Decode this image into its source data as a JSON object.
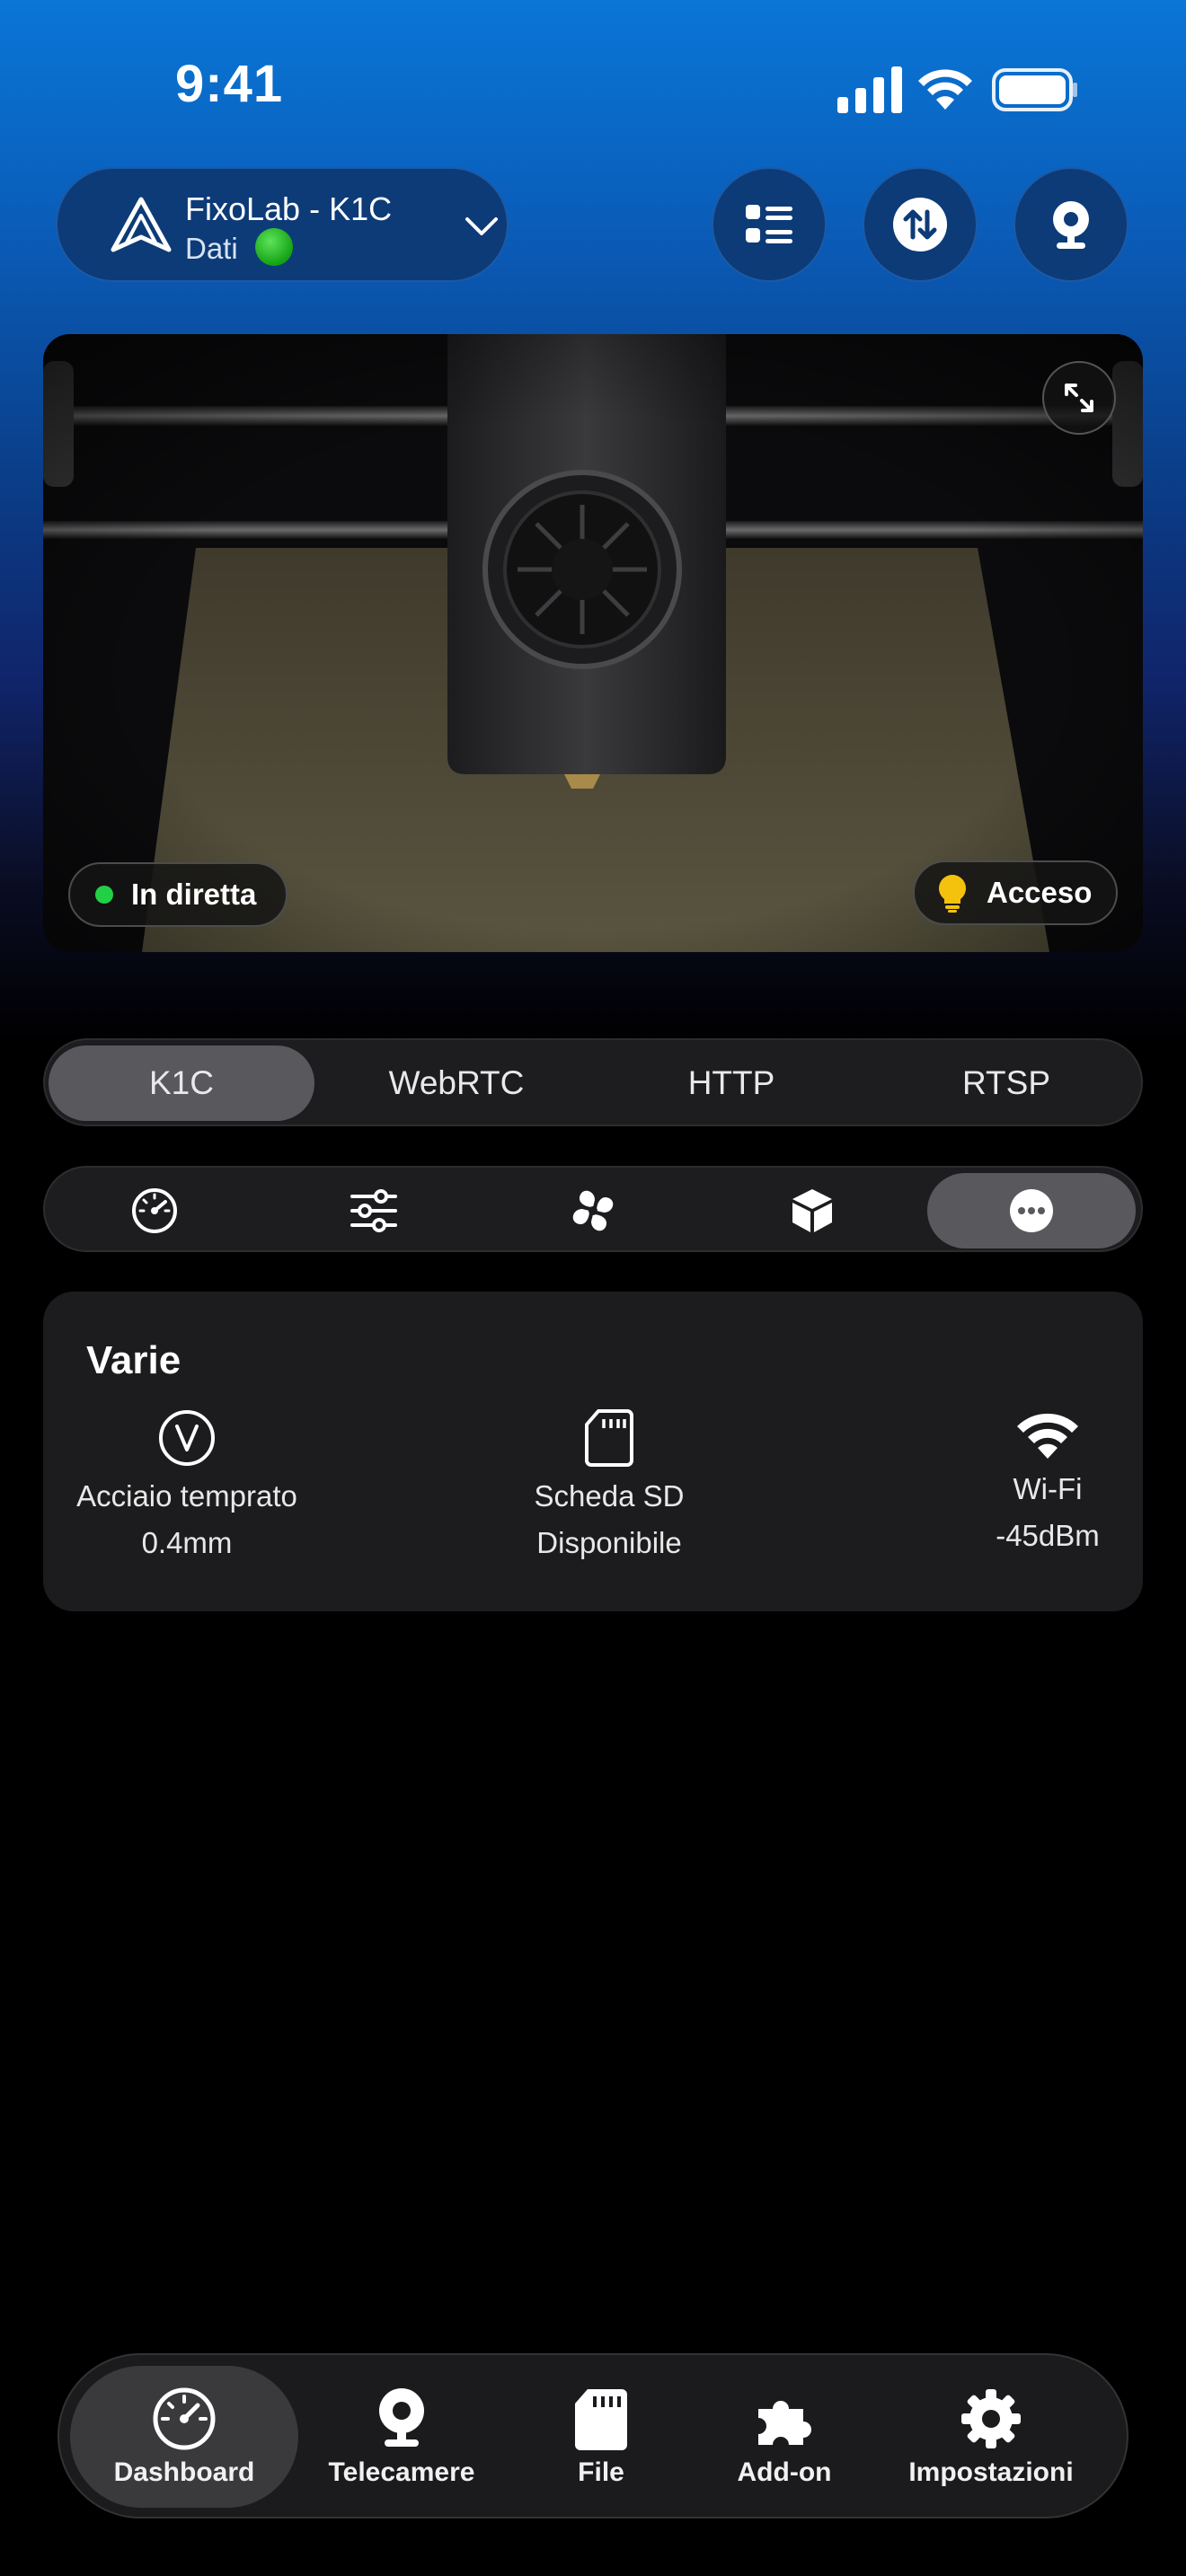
{
  "status_bar": {
    "time": "9:41"
  },
  "header": {
    "printer_name": "FixoLab - K1C",
    "printer_subtitle": "Dati",
    "status_color": "#22c42a",
    "buttons": [
      "list-icon",
      "transfer-icon",
      "webcam-icon"
    ]
  },
  "camera": {
    "live_label": "In diretta",
    "light_label": "Acceso"
  },
  "stream_tabs": [
    "K1C",
    "WebRTC",
    "HTTP",
    "RTSP"
  ],
  "stream_selected": "K1C",
  "tool_tabs": [
    "gauge-icon",
    "sliders-icon",
    "fan-icon",
    "box-icon",
    "more-icon"
  ],
  "tool_selected": "more-icon",
  "card": {
    "title": "Varie",
    "items": [
      {
        "icon": "v-circle-icon",
        "line1": "Acciaio temprato",
        "line2": "0.4mm"
      },
      {
        "icon": "sd-card-icon",
        "line1": "Scheda SD",
        "line2": "Disponibile"
      },
      {
        "icon": "wifi-icon",
        "line1": "Wi-Fi",
        "line2": "-45dBm"
      }
    ]
  },
  "tab_bar": [
    {
      "icon": "dashboard-icon",
      "label": "Dashboard"
    },
    {
      "icon": "webcam-icon",
      "label": "Telecamere"
    },
    {
      "icon": "sd-card-icon",
      "label": "File"
    },
    {
      "icon": "puzzle-icon",
      "label": "Add-on"
    },
    {
      "icon": "gear-icon",
      "label": "Impostazioni"
    }
  ],
  "tab_selected": "Dashboard",
  "colors": {
    "accent_blue": "#0a76d6",
    "live_green": "#21d045",
    "bulb_yellow": "#f4c20d"
  }
}
